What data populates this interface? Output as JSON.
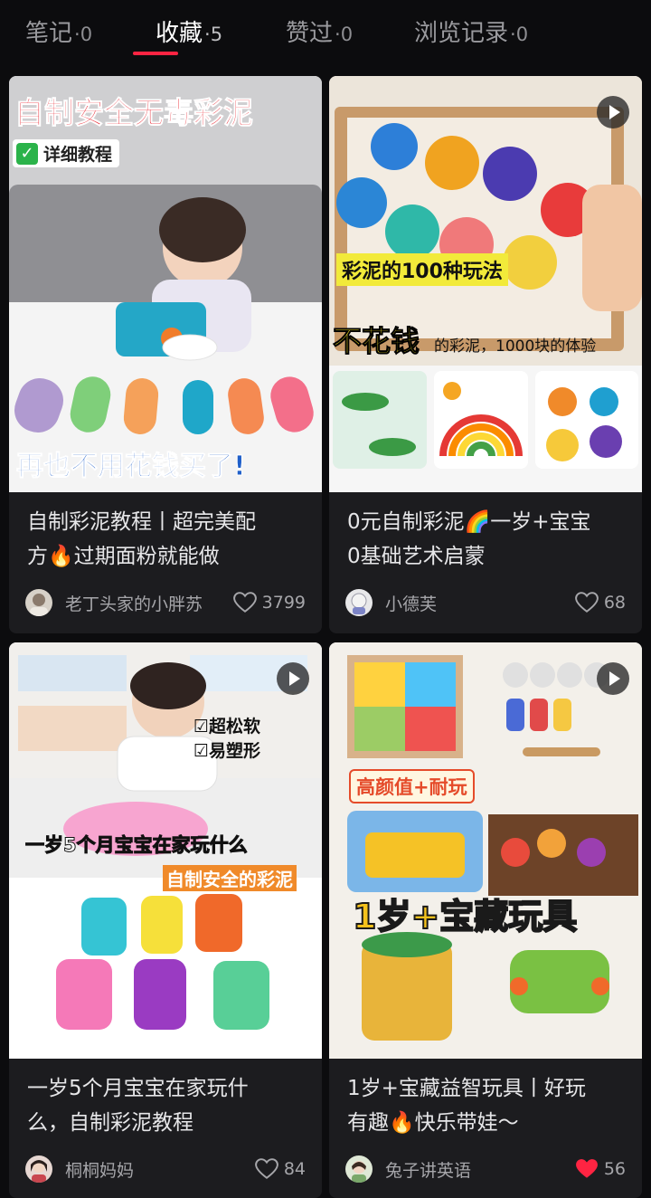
{
  "tabs": [
    {
      "label": "笔记",
      "count": "·0"
    },
    {
      "label": "收藏",
      "count": "·5"
    },
    {
      "label": "赞过",
      "count": "·0"
    },
    {
      "label": "浏览记录",
      "count": "·0"
    }
  ],
  "accent": "#ff2442",
  "cards": [
    {
      "title_line1": "自制彩泥教程丨超完美配",
      "title_line2": "方🔥过期面粉就能做",
      "author": "老丁头家的小胖苏",
      "likes": "3799",
      "liked": false,
      "cover": {
        "top_text": "自制安全无毒彩泥",
        "badge": "详细教程",
        "bottom_text": "再也不用花钱买了!"
      }
    },
    {
      "title_line1": "0元自制彩泥🌈一岁+宝宝",
      "title_line2": "0基础艺术启蒙",
      "author": "小德芙",
      "likes": "68",
      "liked": false,
      "cover": {
        "banner": "彩泥的100种玩法",
        "big": "不花钱",
        "small": "的彩泥，1000块的体验"
      }
    },
    {
      "title_line1": "一岁5个月宝宝在家玩什",
      "title_line2": "么，自制彩泥教程",
      "author": "桐桐妈妈",
      "likes": "84",
      "liked": false,
      "cover": {
        "check1": "超松软",
        "check2": "易塑形",
        "line1": "一岁5个月宝宝在家玩什么",
        "line2": "自制安全的彩泥"
      }
    },
    {
      "title_line1": "1岁+宝藏益智玩具丨好玩",
      "title_line2": "有趣🔥快乐带娃～",
      "author": "兔子讲英语",
      "likes": "56",
      "liked": true,
      "cover": {
        "tag": "高颜值+耐玩",
        "big": "1岁+宝藏玩具"
      }
    }
  ]
}
